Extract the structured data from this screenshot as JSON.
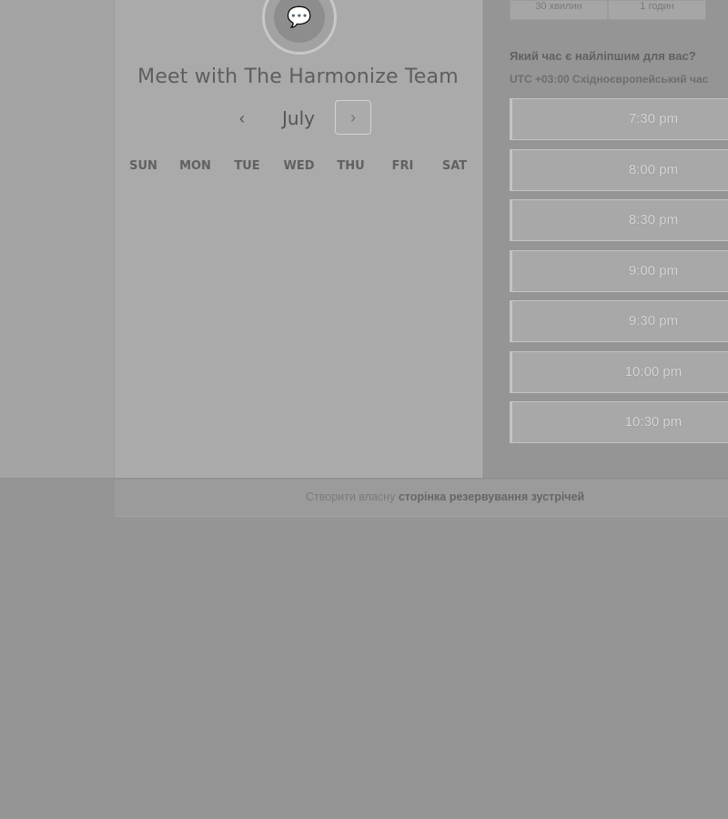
{
  "card": {
    "title": "Meet with The Harmonize Team",
    "month": "July",
    "prev_icon": "‹",
    "next_icon": "›",
    "weekdays": [
      "SUN",
      "MON",
      "TUE",
      "WED",
      "THU",
      "FRI",
      "SAT"
    ]
  },
  "durations": [
    "30 хвилин",
    "1 годин"
  ],
  "question": "Який час є найліпшим для вас?",
  "timezone": "UTC +03:00 Східноєвропейський час",
  "slots": [
    "7:30 pm",
    "8:00 pm",
    "8:30 pm",
    "9:00 pm",
    "9:30 pm",
    "10:00 pm",
    "10:30 pm"
  ],
  "footer": {
    "prefix": "Створити власну",
    "link": "сторінка резервування зустрічей"
  }
}
